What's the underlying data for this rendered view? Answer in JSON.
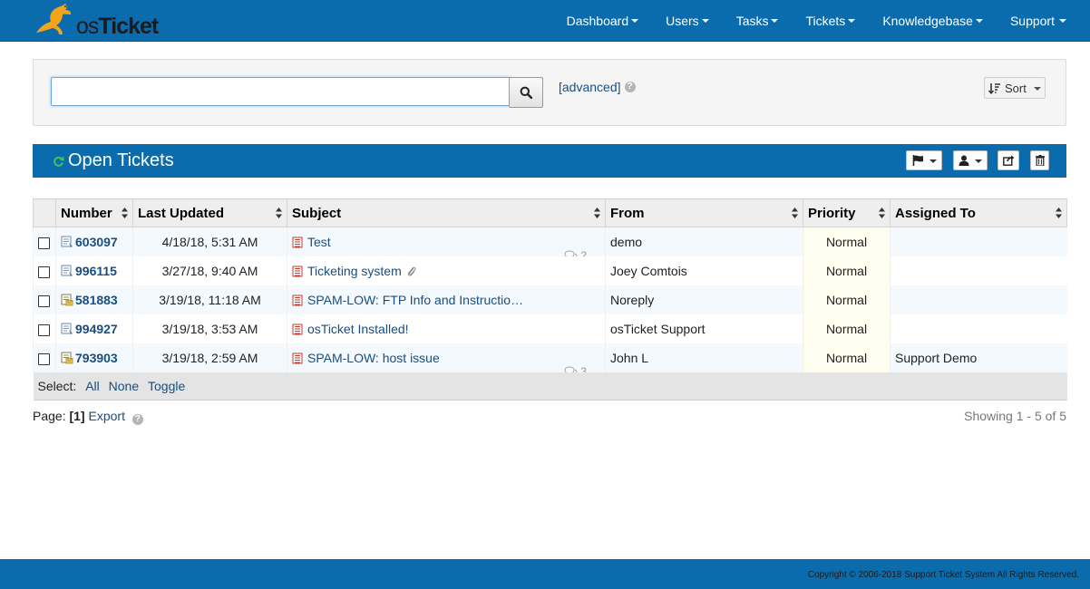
{
  "app": {
    "logo_text": "osTicket",
    "logo_prefix": "os",
    "logo_suffix": "Ticket",
    "colors": {
      "nav": "#0a6cad",
      "link": "#184e81",
      "priority_bg": "#fffdef"
    }
  },
  "nav": [
    {
      "label": "Dashboard"
    },
    {
      "label": "Users"
    },
    {
      "label": "Tasks"
    },
    {
      "label": "Tickets"
    },
    {
      "label": "Knowledgebase"
    },
    {
      "label": "Support"
    }
  ],
  "search": {
    "value": "",
    "advanced_label": "[advanced]",
    "sort_label": "Sort",
    "search_icon": "search-icon"
  },
  "section": {
    "title": "Open Tickets",
    "tools": [
      "flag-icon",
      "user-icon",
      "share-icon",
      "trash-icon"
    ]
  },
  "table": {
    "columns": [
      "Number",
      "Last Updated",
      "Subject",
      "From",
      "Priority",
      "Assigned To"
    ],
    "rows": [
      {
        "number": "603097",
        "updated": "4/18/18, 5:31 AM",
        "subject": "Test",
        "thread_count": "2",
        "attachment": false,
        "from": "demo",
        "priority": "Normal",
        "assigned": ""
      },
      {
        "number": "996115",
        "updated": "3/27/18, 9:40 AM",
        "subject": "Ticketing system",
        "thread_count": "",
        "attachment": true,
        "from": "Joey Comtois",
        "priority": "Normal",
        "assigned": ""
      },
      {
        "number": "581883",
        "updated": "3/19/18, 11:18 AM",
        "subject": "SPAM-LOW: FTP Info and Instructio…",
        "thread_count": "",
        "attachment": false,
        "from": "Noreply",
        "priority": "Normal",
        "assigned": ""
      },
      {
        "number": "994927",
        "updated": "3/19/18, 3:53 AM",
        "subject": "osTicket Installed!",
        "thread_count": "",
        "attachment": false,
        "from": "osTicket Support",
        "priority": "Normal",
        "assigned": ""
      },
      {
        "number": "793903",
        "updated": "3/19/18, 2:59 AM",
        "subject": "SPAM-LOW: host issue",
        "thread_count": "3",
        "attachment": false,
        "from": "John L",
        "priority": "Normal",
        "assigned": "Support Demo"
      }
    ],
    "select": {
      "label": "Select:",
      "all": "All",
      "none": "None",
      "toggle": "Toggle"
    }
  },
  "pager": {
    "page_label": "Page:",
    "current": "[1]",
    "export": "Export",
    "showing": "Showing 1 - 5 of 5"
  },
  "footer": {
    "copyright": "Copyright © 2006-2018 Support Ticket System All Rights Reserved."
  }
}
